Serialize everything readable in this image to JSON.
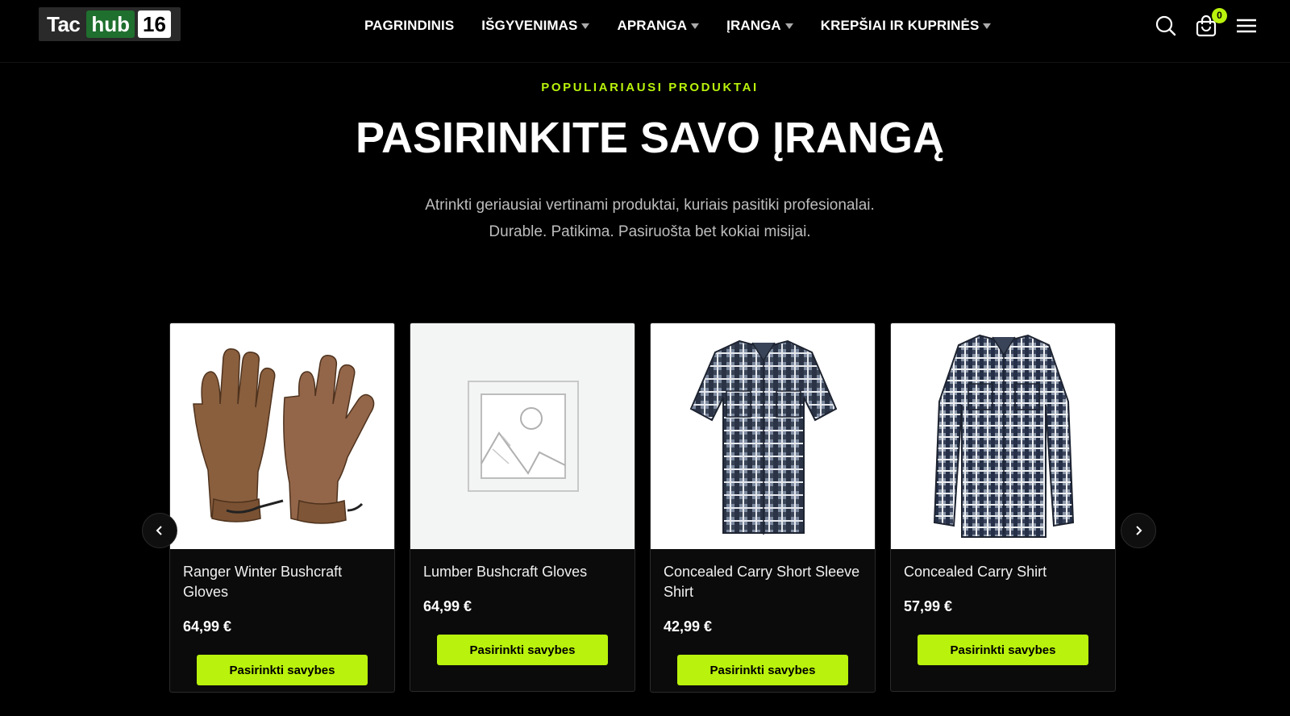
{
  "header": {
    "logo": {
      "part1": "Tac",
      "part2": "hub",
      "part3": "16"
    },
    "nav": [
      {
        "label": "PAGRINDINIS",
        "dropdown": false
      },
      {
        "label": "IŠGYVENIMAS",
        "dropdown": true
      },
      {
        "label": "APRANGA",
        "dropdown": true
      },
      {
        "label": "ĮRANGA",
        "dropdown": true
      },
      {
        "label": "KREPŠIAI IR KUPRINĖS",
        "dropdown": true
      }
    ],
    "icons": [
      "search-icon",
      "cart-icon",
      "menu-icon"
    ],
    "cart_count": "0"
  },
  "hero": {
    "eyebrow": "POPULIARIAUSI PRODUKTAI",
    "title": "PASIRINKITE SAVO ĮRANGĄ",
    "subtitle_line1": "Atrinkti geriausiai vertinami produktai, kuriais pasitiki profesionalai.",
    "subtitle_line2": "Durable. Patikima. Pasiruošta bet kokiai misijai."
  },
  "products": [
    {
      "name": "Ranger Winter Bushcraft Gloves",
      "price": "64,99 €",
      "button": "Pasirinkti savybes",
      "image": "gloves"
    },
    {
      "name": "Lumber Bushcraft Gloves",
      "price": "64,99 €",
      "button": "Pasirinkti savybes",
      "image": "placeholder"
    },
    {
      "name": "Concealed Carry Short Sleeve Shirt",
      "price": "42,99 €",
      "button": "Pasirinkti savybes",
      "image": "short-sleeve-shirt"
    },
    {
      "name": "Concealed Carry Shirt",
      "price": "57,99 €",
      "button": "Pasirinkti savybes",
      "image": "long-sleeve-shirt"
    }
  ],
  "colors": {
    "accent": "#b9f20c",
    "background": "#000000",
    "card": "#0b0b0b"
  }
}
